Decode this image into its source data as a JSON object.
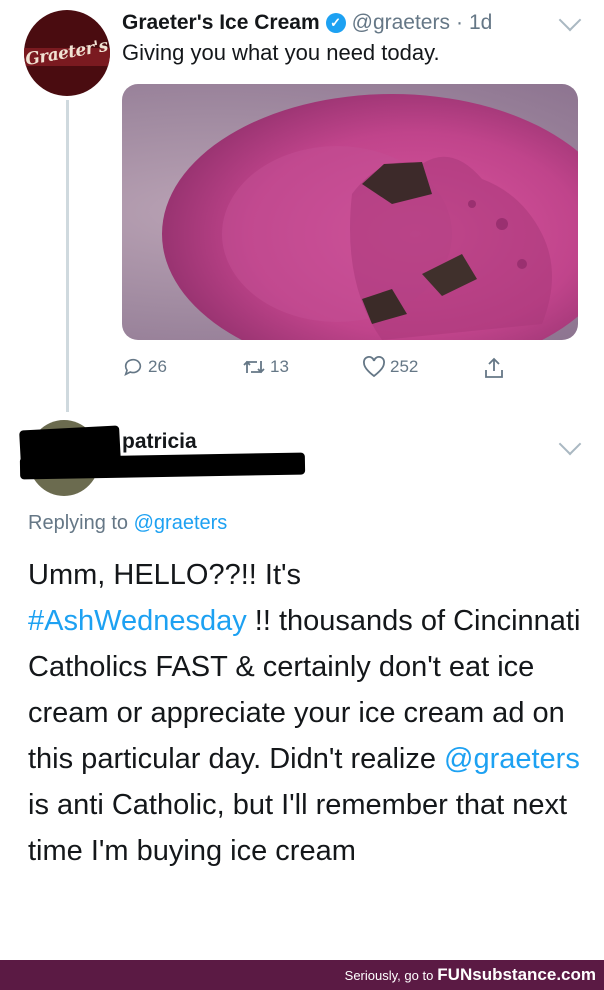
{
  "tweet": {
    "author_name": "Graeter's Ice Cream",
    "handle": "@graeters",
    "separator": "·",
    "time": "1d",
    "avatar_text": "Graeter's",
    "text": "Giving you what you need today.",
    "media_alt": "ice cream",
    "replies": "26",
    "retweets": "13",
    "likes": "252"
  },
  "reply": {
    "author_name": "patricia",
    "replying_prefix": "Replying to",
    "replying_handle": "@graeters",
    "text_part1": "Umm, HELLO??!!  It's",
    "hashtag": "#AshWednesday",
    "text_part2": " !! thousands of Cincinnati Catholics FAST & certainly don't eat ice cream or appreciate your ice cream ad on this particular day. Didn't realize ",
    "mention": "@graeters",
    "text_part3": " is anti Catholic, but I'll remember that next time I'm buying ice cream"
  },
  "footer": {
    "text": "Seriously, go to",
    "brand": "FUNsubstance.com"
  },
  "colors": {
    "link": "#1da1f2",
    "muted": "#657786",
    "footer_bg": "#5b1a44",
    "avatar_bg": "#4a0c10"
  },
  "icons": [
    "verified-badge-icon",
    "chevron-down-icon",
    "reply-icon",
    "retweet-icon",
    "like-icon",
    "share-icon"
  ]
}
